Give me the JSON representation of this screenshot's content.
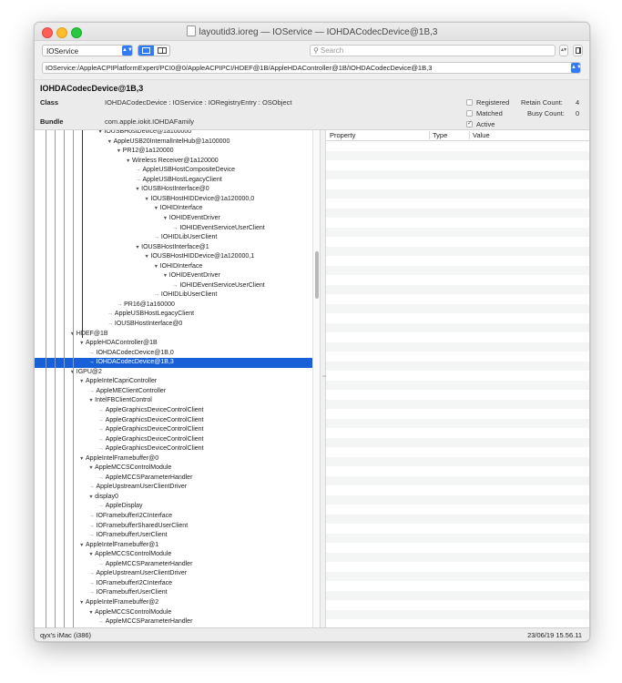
{
  "window": {
    "title": "layoutid3.ioreg — IOService — IOHDACodecDevice@1B,3"
  },
  "toolbar": {
    "plane": "IOService",
    "search_placeholder": "Search",
    "path": "IOService:/AppleACPIPlatformExpert/PCI0@0/AppleACPIPCI/HDEF@1B/AppleHDAController@1B/IOHDACodecDevice@1B,3"
  },
  "detail": {
    "object_name": "IOHDACodecDevice@1B,3",
    "class_label": "Class",
    "class_value": "IOHDACodecDevice : IOService : IORegistryEntry : OSObject",
    "bundle_label": "Bundle",
    "bundle_value": "com.apple.iokit.IOHDAFamily",
    "checks": [
      {
        "label": "Registered",
        "checked": false
      },
      {
        "label": "Matched",
        "checked": false
      },
      {
        "label": "Active",
        "checked": true
      }
    ],
    "retain_label": "Retain Count:",
    "retain_value": "4",
    "busy_label": "Busy Count:",
    "busy_value": "0"
  },
  "tree": [
    {
      "text": "IOUSBHostDevice@1a100000",
      "depth": 7,
      "kind": "twisty"
    },
    {
      "text": "AppleUSB20InternalIntelHub@1a100000",
      "depth": 8,
      "kind": "twisty"
    },
    {
      "text": "PR12@1a120000",
      "depth": 9,
      "kind": "twisty"
    },
    {
      "text": "Wireless Receiver@1a120000",
      "depth": 10,
      "kind": "twisty"
    },
    {
      "text": "AppleUSBHostCompositeDevice",
      "depth": 11,
      "kind": "leaf"
    },
    {
      "text": "AppleUSBHostLegacyClient",
      "depth": 11,
      "kind": "leaf"
    },
    {
      "text": "IOUSBHostInterface@0",
      "depth": 11,
      "kind": "twisty"
    },
    {
      "text": "IOUSBHostHIDDevice@1a120000,0",
      "depth": 12,
      "kind": "twisty"
    },
    {
      "text": "IOHIDInterface",
      "depth": 13,
      "kind": "twisty"
    },
    {
      "text": "IOHIDEventDriver",
      "depth": 14,
      "kind": "twisty"
    },
    {
      "text": "IOHIDEventServiceUserClient",
      "depth": 15,
      "kind": "leaf"
    },
    {
      "text": "IOHIDLibUserClient",
      "depth": 13,
      "kind": "leaf"
    },
    {
      "text": "IOUSBHostInterface@1",
      "depth": 11,
      "kind": "twisty"
    },
    {
      "text": "IOUSBHostHIDDevice@1a120000,1",
      "depth": 12,
      "kind": "twisty"
    },
    {
      "text": "IOHIDInterface",
      "depth": 13,
      "kind": "twisty"
    },
    {
      "text": "IOHIDEventDriver",
      "depth": 14,
      "kind": "twisty"
    },
    {
      "text": "IOHIDEventServiceUserClient",
      "depth": 15,
      "kind": "leaf"
    },
    {
      "text": "IOHIDLibUserClient",
      "depth": 13,
      "kind": "leaf"
    },
    {
      "text": "PR16@1a160000",
      "depth": 9,
      "kind": "leaf"
    },
    {
      "text": "AppleUSBHostLegacyClient",
      "depth": 8,
      "kind": "leaf"
    },
    {
      "text": "IOUSBHostInterface@0",
      "depth": 8,
      "kind": "leaf"
    },
    {
      "text": "HDEF@1B",
      "depth": 4,
      "kind": "twisty"
    },
    {
      "text": "AppleHDAController@1B",
      "depth": 5,
      "kind": "twisty"
    },
    {
      "text": "IOHDACodecDevice@1B,0",
      "depth": 6,
      "kind": "leaf"
    },
    {
      "text": "IOHDACodecDevice@1B,3",
      "depth": 6,
      "kind": "leaf",
      "selected": true
    },
    {
      "text": "IGPU@2",
      "depth": 4,
      "kind": "twisty"
    },
    {
      "text": "AppleIntelCapriController",
      "depth": 5,
      "kind": "twisty"
    },
    {
      "text": "AppleMEClientController",
      "depth": 6,
      "kind": "leaf"
    },
    {
      "text": "IntelFBClientControl",
      "depth": 6,
      "kind": "twisty"
    },
    {
      "text": "AppleGraphicsDeviceControlClient",
      "depth": 7,
      "kind": "leaf"
    },
    {
      "text": "AppleGraphicsDeviceControlClient",
      "depth": 7,
      "kind": "leaf"
    },
    {
      "text": "AppleGraphicsDeviceControlClient",
      "depth": 7,
      "kind": "leaf"
    },
    {
      "text": "AppleGraphicsDeviceControlClient",
      "depth": 7,
      "kind": "leaf"
    },
    {
      "text": "AppleGraphicsDeviceControlClient",
      "depth": 7,
      "kind": "leaf"
    },
    {
      "text": "AppleIntelFramebuffer@0",
      "depth": 5,
      "kind": "twisty"
    },
    {
      "text": "AppleMCCSControlModule",
      "depth": 6,
      "kind": "twisty"
    },
    {
      "text": "AppleMCCSParameterHandler",
      "depth": 7,
      "kind": "leaf"
    },
    {
      "text": "AppleUpstreamUserClientDriver",
      "depth": 6,
      "kind": "leaf"
    },
    {
      "text": "display0",
      "depth": 6,
      "kind": "twisty"
    },
    {
      "text": "AppleDisplay",
      "depth": 7,
      "kind": "leaf"
    },
    {
      "text": "IOFramebufferI2CInterface",
      "depth": 6,
      "kind": "leaf"
    },
    {
      "text": "IOFramebufferSharedUserClient",
      "depth": 6,
      "kind": "leaf"
    },
    {
      "text": "IOFramebufferUserClient",
      "depth": 6,
      "kind": "leaf"
    },
    {
      "text": "AppleIntelFramebuffer@1",
      "depth": 5,
      "kind": "twisty"
    },
    {
      "text": "AppleMCCSControlModule",
      "depth": 6,
      "kind": "twisty"
    },
    {
      "text": "AppleMCCSParameterHandler",
      "depth": 7,
      "kind": "leaf"
    },
    {
      "text": "AppleUpstreamUserClientDriver",
      "depth": 6,
      "kind": "leaf"
    },
    {
      "text": "IOFramebufferI2CInterface",
      "depth": 6,
      "kind": "leaf"
    },
    {
      "text": "IOFramebufferUserClient",
      "depth": 6,
      "kind": "leaf"
    },
    {
      "text": "AppleIntelFramebuffer@2",
      "depth": 5,
      "kind": "twisty"
    },
    {
      "text": "AppleMCCSControlModule",
      "depth": 6,
      "kind": "twisty"
    },
    {
      "text": "AppleMCCSParameterHandler",
      "depth": 7,
      "kind": "leaf"
    }
  ],
  "properties": {
    "headers": [
      "Property",
      "Type",
      "Value"
    ]
  },
  "status": {
    "machine": "qyx's iMac (i386)",
    "timestamp": "23/06/19 15.56.11"
  },
  "colors": {
    "selection": "#1860d8",
    "accent": "#2f7cf6"
  }
}
